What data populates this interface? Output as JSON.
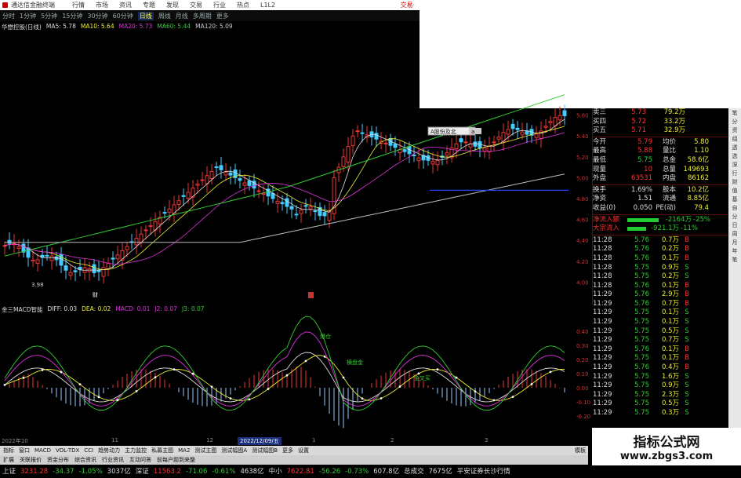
{
  "titlebar": {
    "title": "通达信金融终端",
    "menus": [
      "行情",
      "市场",
      "资讯",
      "专题",
      "发现",
      "交易",
      "行业",
      "热点",
      "L1L2"
    ],
    "trade": "交易·"
  },
  "periods": {
    "items": [
      "分时",
      "1分钟",
      "5分钟",
      "15分钟",
      "30分钟",
      "60分钟",
      "日线",
      "周线",
      "月线",
      "多周期",
      "更多"
    ],
    "selected": 6
  },
  "ma_header": {
    "stock": "华懋控股(日线)",
    "items": [
      {
        "t": "MA5: 5.78",
        "c": "#ddd"
      },
      {
        "t": "MA10: 5.64",
        "c": "#ee3"
      },
      {
        "t": "MA20: 5.73",
        "c": "#d3d"
      },
      {
        "t": "MA60: 5.44",
        "c": "#3c3"
      },
      {
        "t": "MA120: 5.09",
        "c": "#ccc"
      }
    ]
  },
  "price_axis": [
    "5.60",
    "5.40",
    "5.20",
    "5.00",
    "4.80",
    "4.60",
    "4.40",
    "4.20",
    "4.00"
  ],
  "low_label": "3.98",
  "tooltip": "A股份及北",
  "tooltip2": "a",
  "marker_cai": "财",
  "macd_header": {
    "title": "金三MACD智能",
    "items": [
      {
        "t": "DIFF: 0.03",
        "c": "#ddd"
      },
      {
        "t": "DEA: 0.02",
        "c": "#ee3"
      },
      {
        "t": "MACD: 0.01",
        "c": "#d3d"
      },
      {
        "t": "J2: 0.07",
        "c": "#d3d"
      },
      {
        "t": "J3: 0.07",
        "c": "#3c3"
      }
    ]
  },
  "macd_labels": {
    "a": "爆仓",
    "b": "横盘金",
    "c": "金叉买"
  },
  "macd_axis": [
    "0.40",
    "0.30",
    "0.20",
    "0.10",
    "0.00",
    "-0.10",
    "-0.20"
  ],
  "time_axis": {
    "labels": [
      "2022年10",
      "11",
      "12",
      "1",
      "2",
      "3"
    ],
    "date": "2022/12/09/五"
  },
  "tabs1": [
    "指标",
    "窗口",
    "MACD",
    "VOL-TDX",
    "CCI",
    "趋势动力",
    "主力监控",
    "私募主图",
    "MA2",
    "测试主图",
    "测试幅图A",
    "测试幅图B",
    "更多",
    "设置"
  ],
  "tabs1_right": "模板",
  "tabs2": [
    "扩展",
    "关联报价",
    "资金分布",
    "综合资讯",
    "行业资讯",
    "互动问答",
    "前每户题到来整"
  ],
  "side": {
    "quotes": [
      {
        "l": "卖三",
        "p": "5.73",
        "v": "79.2万"
      },
      {
        "l": "买四",
        "p": "5.72",
        "v": "33.2万"
      },
      {
        "l": "买五",
        "p": "5.71",
        "v": "32.9万"
      }
    ],
    "stats": [
      {
        "l1": "今开",
        "v1": "5.79",
        "l2": "均价",
        "v2": "5.80",
        "c1": "up"
      },
      {
        "l1": "最高",
        "v1": "5.88",
        "l2": "量比",
        "v2": "1.10",
        "c1": "up"
      },
      {
        "l1": "最低",
        "v1": "5.75",
        "l2": "总金",
        "v2": "58.6亿",
        "c1": "dn"
      },
      {
        "l1": "现量",
        "v1": "10",
        "l2": "总量",
        "v2": "149693",
        "c1": "up"
      },
      {
        "l1": "外盘",
        "v1": "63531",
        "l2": "内盘",
        "v2": "86162",
        "c1": "up"
      },
      {
        "l1": "换手",
        "v1": "1.69%",
        "l2": "股本",
        "v2": "10.2亿",
        "c1": "wh"
      },
      {
        "l1": "净资",
        "v1": "1.51",
        "l2": "流通",
        "v2": "8.85亿",
        "c1": "wh"
      },
      {
        "l1": "收益(0)",
        "v1": "0.050",
        "l2": "PE(动)",
        "v2": "79.4",
        "c1": "wh"
      }
    ],
    "flows": [
      {
        "l": "净流入额",
        "v": "-2164万",
        "p": "-25%"
      },
      {
        "l": "大宗流入",
        "v": "-921.1万",
        "p": "-11%"
      }
    ],
    "ticks": [
      {
        "t": "11:28",
        "p": "5.76",
        "v": "0.7万",
        "d": "B"
      },
      {
        "t": "11:28",
        "p": "5.76",
        "v": "0.2万",
        "d": "B"
      },
      {
        "t": "11:28",
        "p": "5.76",
        "v": "0.1万",
        "d": "B"
      },
      {
        "t": "11:28",
        "p": "5.75",
        "v": "0.9万",
        "d": "S"
      },
      {
        "t": "11:28",
        "p": "5.75",
        "v": "0.2万",
        "d": "S"
      },
      {
        "t": "11:28",
        "p": "5.76",
        "v": "0.1万",
        "d": "B"
      },
      {
        "t": "11:29",
        "p": "5.76",
        "v": "2.9万",
        "d": "B"
      },
      {
        "t": "11:29",
        "p": "5.76",
        "v": "0.7万",
        "d": "B"
      },
      {
        "t": "11:29",
        "p": "5.75",
        "v": "0.1万",
        "d": "S"
      },
      {
        "t": "11:29",
        "p": "5.75",
        "v": "0.1万",
        "d": "S"
      },
      {
        "t": "11:29",
        "p": "5.75",
        "v": "0.5万",
        "d": "S"
      },
      {
        "t": "11:29",
        "p": "5.75",
        "v": "0.7万",
        "d": "S"
      },
      {
        "t": "11:29",
        "p": "5.76",
        "v": "0.1万",
        "d": "B"
      },
      {
        "t": "11:29",
        "p": "5.75",
        "v": "0.1万",
        "d": "B"
      },
      {
        "t": "11:29",
        "p": "5.76",
        "v": "0.4万",
        "d": "B"
      },
      {
        "t": "11:29",
        "p": "5.75",
        "v": "1.6万",
        "d": "S"
      },
      {
        "t": "11:29",
        "p": "5.75",
        "v": "0.9万",
        "d": "S"
      },
      {
        "t": "11:29",
        "p": "5.75",
        "v": "2.3万",
        "d": "S"
      },
      {
        "t": "11:29",
        "p": "5.75",
        "v": "0.5万",
        "d": "S"
      },
      {
        "t": "11:29",
        "p": "5.75",
        "v": "0.3万",
        "d": "S"
      }
    ]
  },
  "rtabs": [
    "笔",
    "分",
    "资",
    "组",
    "透",
    "选",
    "深",
    "行",
    "财",
    "值",
    "基",
    "自",
    "分",
    "日",
    "周",
    "月",
    "年",
    "笔"
  ],
  "watermark": {
    "cn": "指标公式网",
    "url": "www.zbgs3.com"
  },
  "status": [
    {
      "t": "上证",
      "c": "wh"
    },
    {
      "t": "3231.28",
      "c": "up"
    },
    {
      "t": "-34.37",
      "c": "dn"
    },
    {
      "t": "-1.05%",
      "c": "dn"
    },
    {
      "t": "3037亿",
      "c": "wh"
    },
    {
      "t": "深证",
      "c": "wh"
    },
    {
      "t": "11563.2",
      "c": "up"
    },
    {
      "t": "-71.06",
      "c": "dn"
    },
    {
      "t": "-0.61%",
      "c": "dn"
    },
    {
      "t": "4638亿",
      "c": "wh"
    },
    {
      "t": "中小",
      "c": "wh"
    },
    {
      "t": "7622.81",
      "c": "up"
    },
    {
      "t": "-56.26",
      "c": "dn"
    },
    {
      "t": "-0.73%",
      "c": "dn"
    },
    {
      "t": "607.8亿",
      "c": "wh"
    },
    {
      "t": "总成交",
      "c": "wh"
    },
    {
      "t": "7675亿",
      "c": "wh"
    },
    {
      "t": "平安证券长沙行情",
      "c": "wh"
    }
  ]
}
